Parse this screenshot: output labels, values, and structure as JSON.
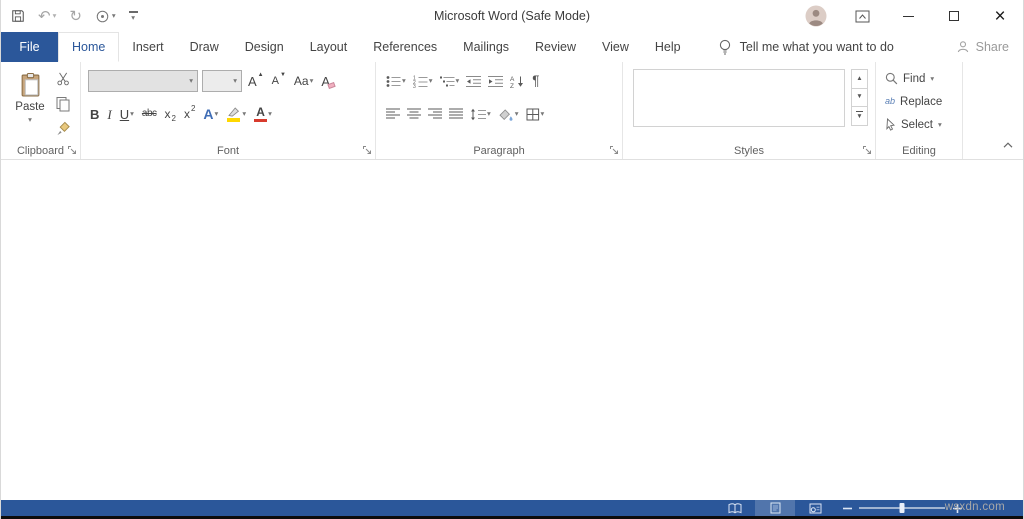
{
  "titlebar": {
    "title": "Microsoft Word (Safe Mode)"
  },
  "tabs": {
    "file": "File",
    "items": [
      {
        "label": "Home",
        "selected": true
      },
      {
        "label": "Insert"
      },
      {
        "label": "Draw"
      },
      {
        "label": "Design"
      },
      {
        "label": "Layout"
      },
      {
        "label": "References"
      },
      {
        "label": "Mailings"
      },
      {
        "label": "Review"
      },
      {
        "label": "View"
      },
      {
        "label": "Help"
      }
    ],
    "tell_me": "Tell me what you want to do",
    "share": "Share"
  },
  "ribbon": {
    "clipboard": {
      "label": "Clipboard",
      "paste": "Paste"
    },
    "font": {
      "label": "Font",
      "grow_font": "A",
      "shrink_font": "A",
      "change_case": "Aa",
      "clear_formatting": "A",
      "bold": "B",
      "italic": "I",
      "underline": "U",
      "strikethrough": "abc",
      "subscript_base": "x",
      "subscript_mark": "2",
      "superscript_base": "x",
      "superscript_mark": "2",
      "text_effects": "A",
      "font_color": "A"
    },
    "paragraph": {
      "label": "Paragraph",
      "show_marks": "¶",
      "sort_a": "A",
      "sort_z": "Z"
    },
    "styles": {
      "label": "Styles"
    },
    "editing": {
      "label": "Editing",
      "find": "Find",
      "replace": "Replace",
      "select": "Select",
      "replace_glyph": "ab"
    }
  },
  "watermark": "wsxdn.com",
  "colors": {
    "accent": "#2b579a",
    "status_bar": "#2b579a",
    "highlight_yellow": "#ffd800",
    "font_color_red": "#d83b2d"
  }
}
